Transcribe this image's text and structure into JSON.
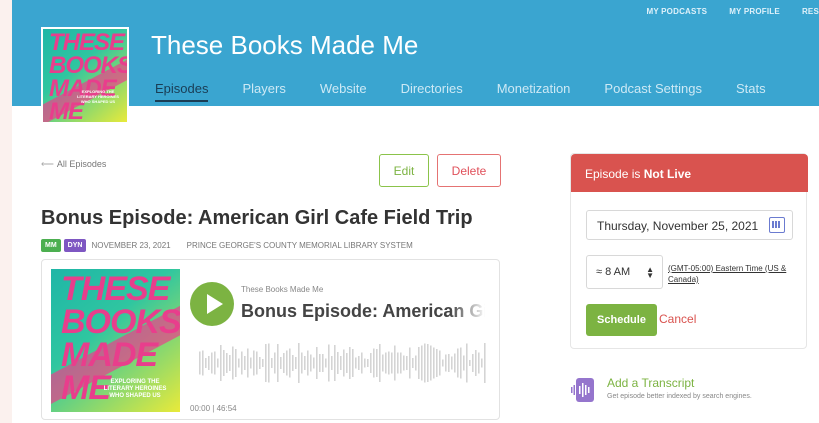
{
  "top_nav": [
    "MY PODCASTS",
    "MY PROFILE",
    "RES"
  ],
  "podcast": {
    "title": "These Books Made Me",
    "cover_words": [
      "THESE",
      "BOOKS",
      "MADE",
      "ME"
    ],
    "cover_subtitle": "EXPLORING THE LITERARY HEROINES WHO SHAPED US"
  },
  "tabs": [
    {
      "label": "Episodes",
      "active": true
    },
    {
      "label": "Players"
    },
    {
      "label": "Website"
    },
    {
      "label": "Directories"
    },
    {
      "label": "Monetization"
    },
    {
      "label": "Podcast Settings"
    },
    {
      "label": "Stats"
    }
  ],
  "actions": {
    "back": "All Episodes",
    "edit": "Edit",
    "delete": "Delete"
  },
  "episode": {
    "title": "Bonus Episode: American Girl Cafe Field Trip",
    "badges": [
      {
        "label": "MM",
        "color": "#4caf50"
      },
      {
        "label": "DYN",
        "color": "#7e57c2"
      }
    ],
    "date": "NOVEMBER 23, 2021",
    "sponsor": "PRINCE GEORGE'S COUNTY MEMORIAL LIBRARY SYSTEM"
  },
  "player": {
    "show": "These Books Made Me",
    "title": "Bonus Episode: American Girl Cafe Field Trip",
    "current_time": "00:00",
    "separator": "|",
    "duration": "46:54"
  },
  "status": {
    "prefix": "Episode is",
    "state": "Not Live",
    "color": "#d9534f"
  },
  "schedule": {
    "date": "Thursday, November 25, 2021",
    "time": "≈ 8 AM",
    "timezone": "(GMT-05:00) Eastern Time (US & Canada)",
    "schedule_label": "Schedule",
    "cancel_label": "Cancel"
  },
  "transcript": {
    "title": "Add a Transcript",
    "subtitle": "Get episode better indexed by search engines."
  },
  "colors": {
    "header": "#3aa5d0",
    "accent_green": "#7cb342",
    "danger": "#d9534f"
  }
}
